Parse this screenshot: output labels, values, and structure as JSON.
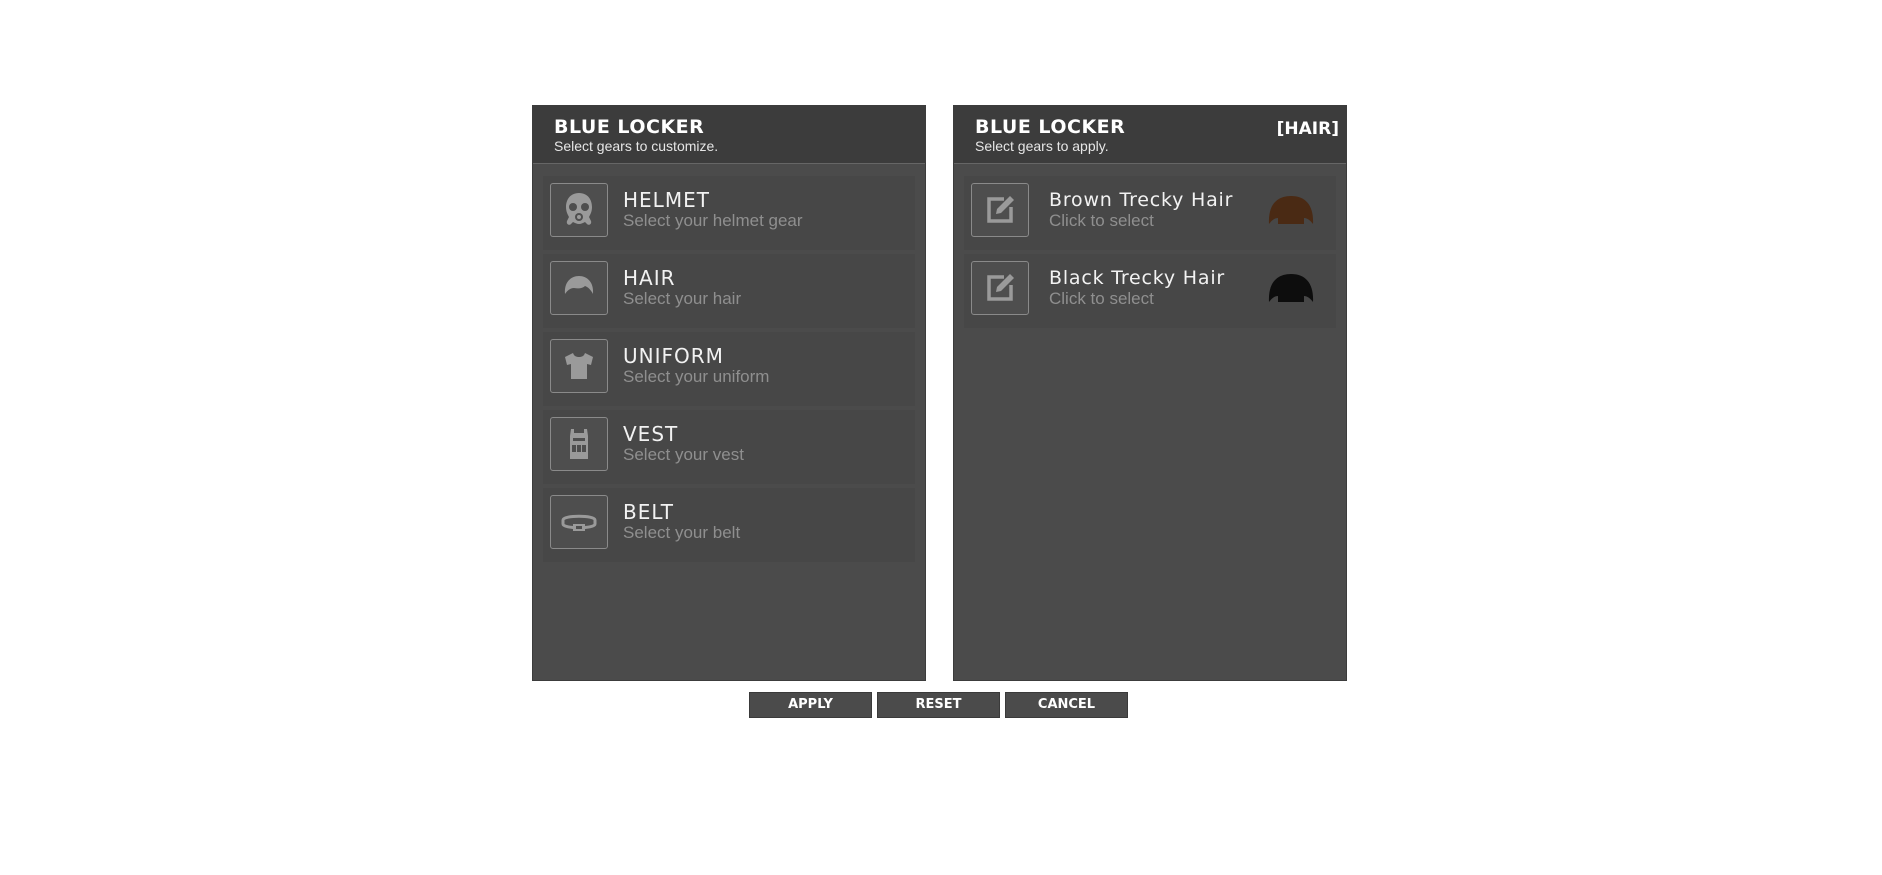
{
  "left_panel": {
    "title": "BLUE LOCKER",
    "subtitle": "Select gears to customize.",
    "items": [
      {
        "title": "HELMET",
        "subtitle": "Select your helmet gear",
        "icon": "gas-mask-icon"
      },
      {
        "title": "HAIR",
        "subtitle": "Select your hair",
        "icon": "hair-icon"
      },
      {
        "title": "UNIFORM",
        "subtitle": "Select your uniform",
        "icon": "tshirt-icon"
      },
      {
        "title": "VEST",
        "subtitle": "Select your vest",
        "icon": "vest-icon"
      },
      {
        "title": "BELT",
        "subtitle": "Select your belt",
        "icon": "belt-icon"
      }
    ]
  },
  "right_panel": {
    "title": "BLUE LOCKER",
    "subtitle": "Select gears to apply.",
    "tag": "[HAIR]",
    "items": [
      {
        "title": "Brown Trecky Hair",
        "subtitle": "Click to select",
        "icon": "edit-icon",
        "thumb_color": "#4a2a14"
      },
      {
        "title": "Black Trecky Hair",
        "subtitle": "Click to select",
        "icon": "edit-icon",
        "thumb_color": "#0d0d0d"
      }
    ]
  },
  "buttons": {
    "apply": "APPLY",
    "reset": "RESET",
    "cancel": "CANCEL"
  },
  "colors": {
    "panel_bg": "#4b4b4b",
    "header_bg": "#3c3c3c",
    "item_bg": "#474747"
  }
}
